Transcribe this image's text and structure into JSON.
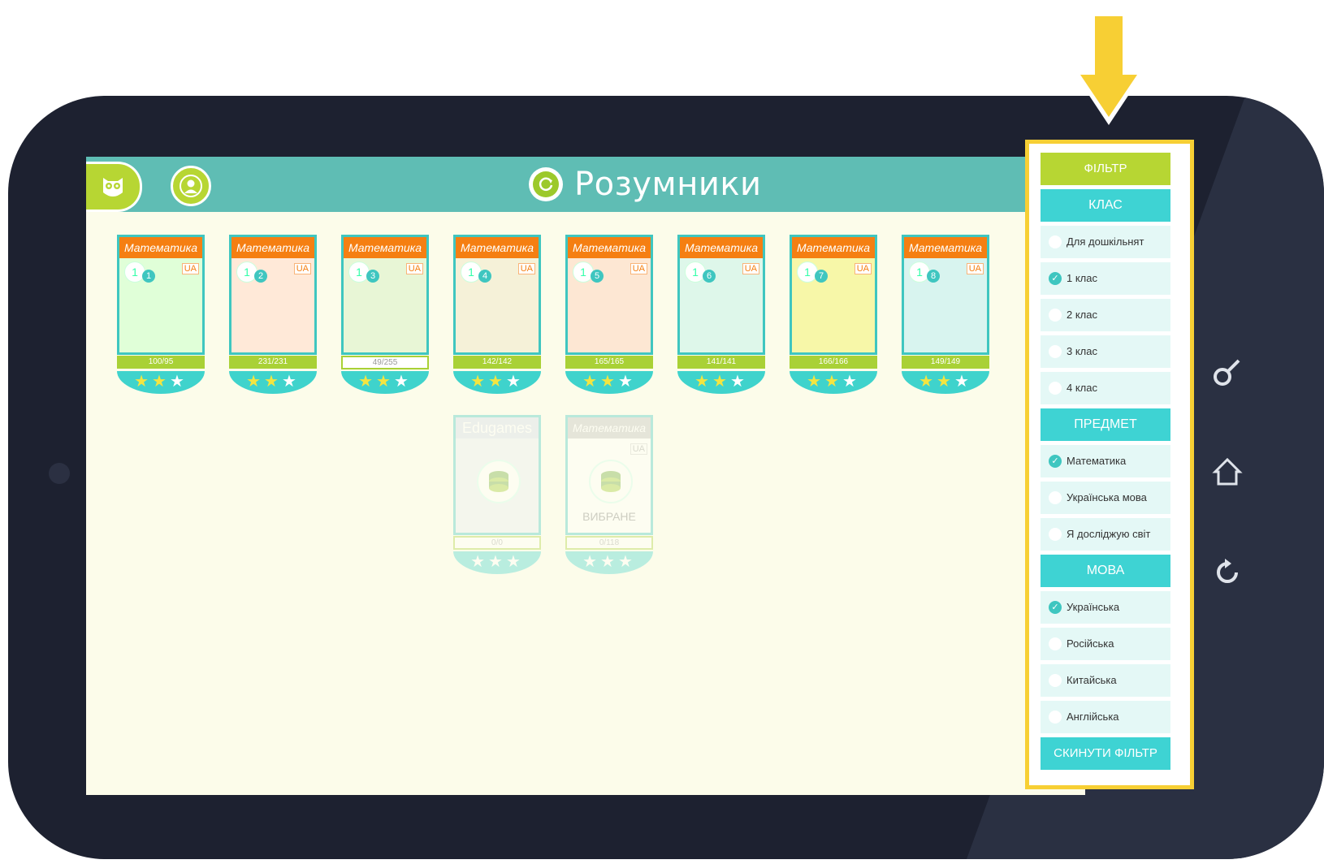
{
  "app": {
    "title": "Розумники"
  },
  "cards": [
    {
      "subject": "Математика",
      "grade": "1",
      "number": "1",
      "lang": "UA",
      "progress": "100/95",
      "stars": 3
    },
    {
      "subject": "Математика",
      "grade": "1",
      "number": "2",
      "lang": "UA",
      "progress": "231/231",
      "stars": 3
    },
    {
      "subject": "Математика",
      "grade": "1",
      "number": "3",
      "lang": "UA",
      "progress": "49/255",
      "stars": 3
    },
    {
      "subject": "Математика",
      "grade": "1",
      "number": "4",
      "lang": "UA",
      "progress": "142/142",
      "stars": 3
    },
    {
      "subject": "Математика",
      "grade": "1",
      "number": "5",
      "lang": "UA",
      "progress": "165/165",
      "stars": 3
    },
    {
      "subject": "Математика",
      "grade": "1",
      "number": "6",
      "lang": "UA",
      "progress": "141/141",
      "stars": 3
    },
    {
      "subject": "Математика",
      "grade": "1",
      "number": "7",
      "lang": "UA",
      "progress": "166/166",
      "stars": 3
    },
    {
      "subject": "Математика",
      "grade": "1",
      "number": "8",
      "lang": "UA",
      "progress": "149/149",
      "stars": 3
    }
  ],
  "download_cards": [
    {
      "title": "Edugames",
      "progress": "0/0"
    },
    {
      "title": "Математика",
      "lang": "UA",
      "label": "ВИБРАНЕ",
      "progress": "0/118"
    }
  ],
  "filter": {
    "title": "ФІЛЬТР",
    "class_header": "КЛАС",
    "class_options": [
      "Для дошкільнят",
      "1 клас",
      "2 клас",
      "3 клас",
      "4 клас"
    ],
    "subject_header": "ПРЕДМЕТ",
    "subject_options": [
      "Математика",
      "Українська мова",
      "Я досліджую світ"
    ],
    "lang_header": "МОВА",
    "lang_options": [
      "Українська",
      "Російська",
      "Китайська",
      "Англійська"
    ],
    "reset": "СКИНУТИ ФІЛЬТР"
  },
  "colors": {
    "accent": "#3ed3d3",
    "lime": "#b7d633",
    "orange": "#f57f12",
    "highlight": "#f7cf34",
    "topbar": "#5fbdb4"
  }
}
